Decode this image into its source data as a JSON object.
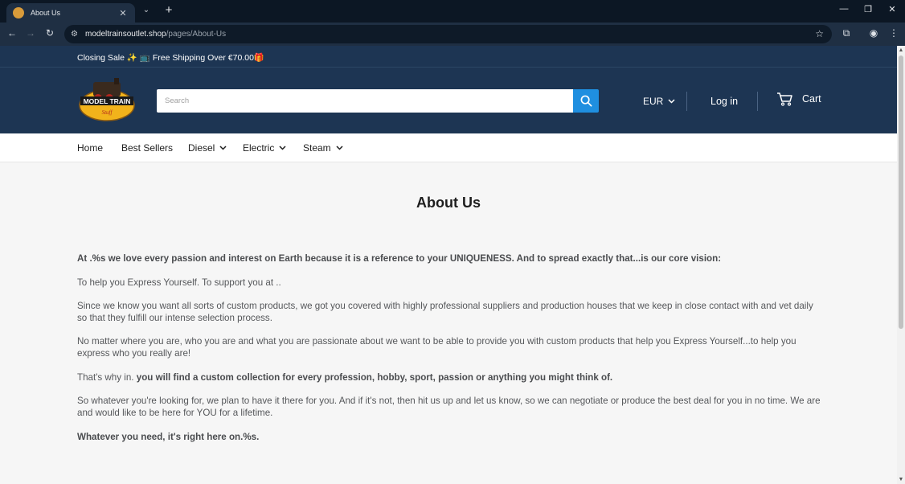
{
  "browser": {
    "tab_title": "About Us",
    "url_host": "modeltrainsoutlet.shop",
    "url_path": "/pages/About-Us"
  },
  "announcement": {
    "text": "Closing Sale ✨ 📺 Free Shipping Over €70.00🎁"
  },
  "header": {
    "logo_alt": "MODEL TRAIN Stuff",
    "search_placeholder": "Search",
    "currency": "EUR",
    "login_label": "Log in",
    "cart_label": "Cart"
  },
  "nav": {
    "items": [
      {
        "label": "Home"
      },
      {
        "label": "Best Sellers"
      },
      {
        "label": "Diesel"
      },
      {
        "label": "Electric"
      },
      {
        "label": "Steam"
      }
    ]
  },
  "main": {
    "title": "About Us",
    "p1": "At .%s we love every passion and interest on Earth because it is a reference to your UNIQUENESS. And to spread exactly that...is our core vision:",
    "p2": "To help you Express Yourself. To support you at ..",
    "p3": "Since we know you want all sorts of custom products, we got you covered with highly professional suppliers and production houses that we keep in close contact with and vet daily so that they fulfill our intense selection process.",
    "p4": "No matter where you are, who you are and what you are passionate about we want to be able to provide you with custom products that help you Express Yourself...to help you express who you really are!",
    "p5_prefix": "That's why in. ",
    "p5_bold": "you will find a custom collection for every profession, hobby, sport, passion or anything you might think of.",
    "p6": "So whatever you're looking for, we plan to have it there for you. And if it's not, then hit us up and let us know, so we can negotiate or produce the best deal for you in no time. We are and would like to be here for YOU for a lifetime.",
    "p7": "Whatever you need, it's right here on.%s."
  }
}
